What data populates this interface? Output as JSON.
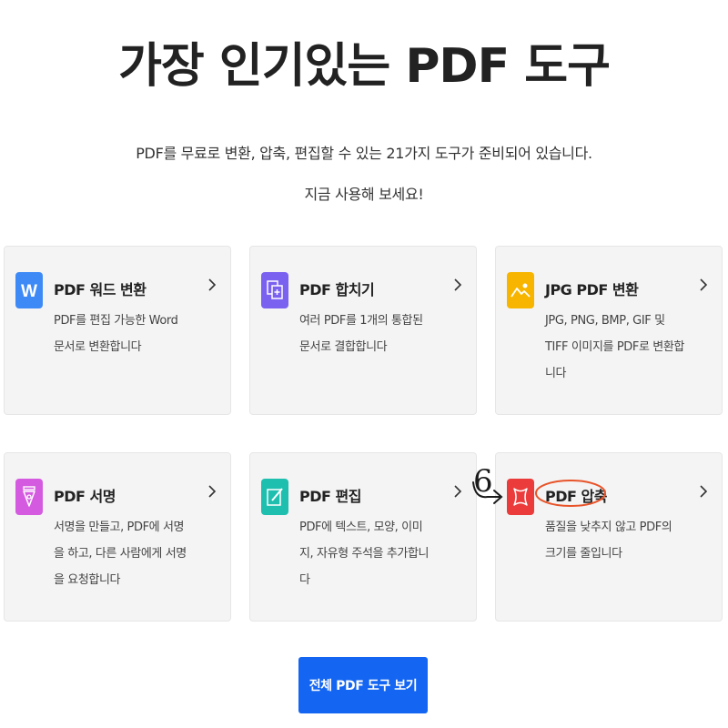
{
  "header": {
    "title": "가장 인기있는 PDF 도구",
    "subtitle_line1": "PDF를 무료로 변환, 압축, 편집할 수 있는 21가지 도구가 준비되어 있습니다.",
    "subtitle_line2": "지금 사용해 보세요!"
  },
  "tools": [
    {
      "title": "PDF 워드 변환",
      "desc": "PDF를 편집 가능한 Word 문서로 변환합니다",
      "icon": "word-icon",
      "color": "#3d8af7"
    },
    {
      "title": "PDF 합치기",
      "desc": "여러 PDF를 1개의 통합된 문서로 결합합니다",
      "icon": "merge-icon",
      "color": "#7b61f0"
    },
    {
      "title": "JPG PDF 변환",
      "desc": "JPG, PNG, BMP, GIF 및 TIFF 이미지를 PDF로 변환합니다",
      "icon": "image-icon",
      "color": "#f7b500"
    },
    {
      "title": "PDF 서명",
      "desc": "서명을 만들고, PDF에 서명을 하고, 다른 사람에게 서명을 요청합니다",
      "icon": "pen-nib-icon",
      "color": "#d45be0"
    },
    {
      "title": "PDF 편집",
      "desc": "PDF에 텍스트, 모양, 이미지, 자유형 주석을 추가합니다",
      "icon": "edit-icon",
      "color": "#1fbfb0"
    },
    {
      "title": "PDF 압축",
      "desc": "품질을 낮추지 않고 PDF의 크기를 줄입니다",
      "icon": "compress-icon",
      "color": "#eb3b3b"
    }
  ],
  "cta": {
    "label": "전체 PDF 도구 보기",
    "color": "#1466f2"
  },
  "annotation": {
    "number": "6",
    "color": "#1a1a1a",
    "circle_color": "#e8542a"
  }
}
